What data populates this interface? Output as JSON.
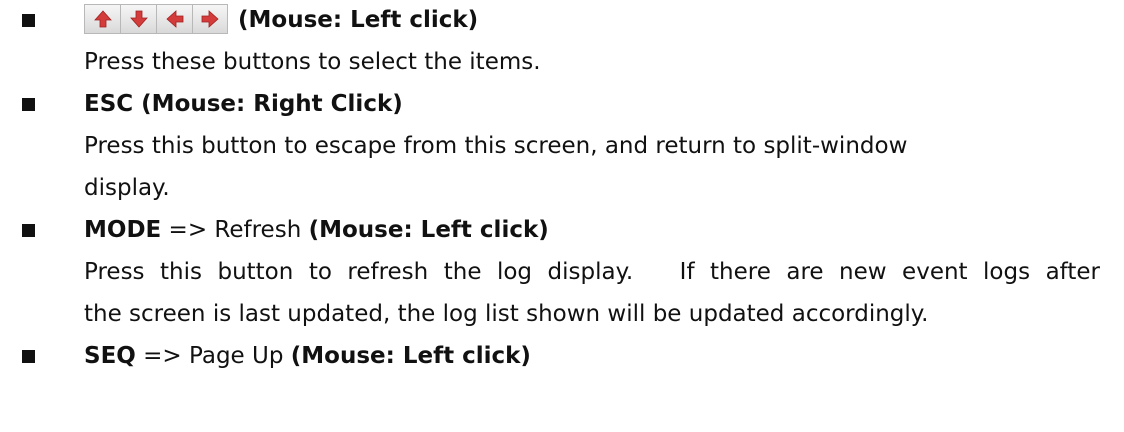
{
  "item1": {
    "buttons": [
      "up-arrow",
      "down-arrow",
      "left-arrow",
      "right-arrow"
    ],
    "mouse": "(Mouse: Left click)",
    "desc": "Press these buttons to select the items."
  },
  "item2": {
    "title": "ESC (Mouse: Right Click)",
    "desc1": "Press this button to escape from this screen, and return to split-window",
    "desc2": "display."
  },
  "item3": {
    "key": "MODE",
    "action": " => Refresh ",
    "mouse": "(Mouse: Left click)",
    "desc1": "Press this button to refresh the log display.   If there are new event logs after",
    "desc2": "the screen is last updated, the log list shown will be updated accordingly."
  },
  "item4": {
    "key": "SEQ",
    "action": " => Page Up ",
    "mouse": "(Mouse: Left click)"
  },
  "colors": {
    "arrow": "#d43c3c",
    "text": "#111111"
  }
}
